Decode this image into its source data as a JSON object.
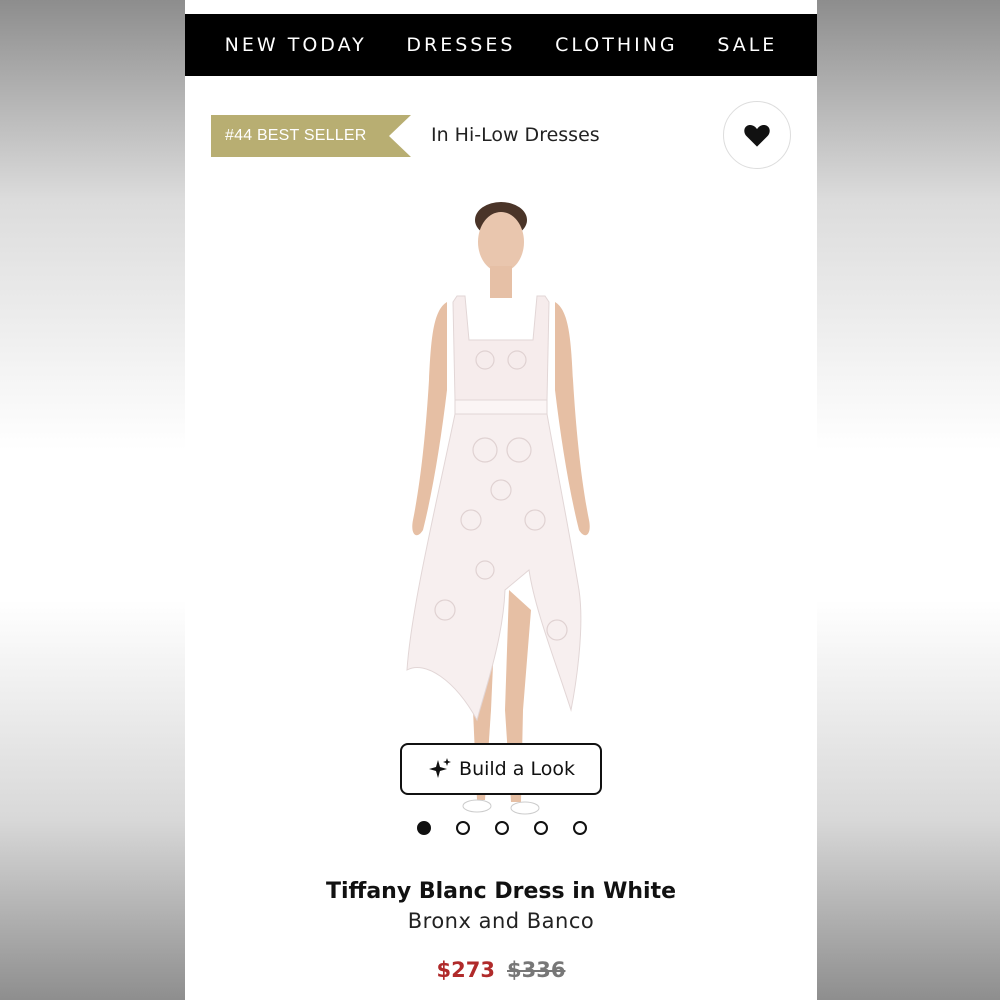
{
  "nav": {
    "items": [
      {
        "label": "NEW TODAY"
      },
      {
        "label": "DRESSES"
      },
      {
        "label": "CLOTHING"
      },
      {
        "label": "SALE"
      }
    ]
  },
  "badge": {
    "rank_label": "#44 BEST SELLER",
    "category": "In Hi-Low Dresses",
    "color": "#b8ae72"
  },
  "favorite": {
    "icon": "heart-icon"
  },
  "image": {
    "description_icon": "product-photo"
  },
  "build_look": {
    "label": "Build a Look",
    "icon": "sparkle-icon"
  },
  "carousel": {
    "count": 5,
    "active_index": 0
  },
  "product": {
    "name": "Tiffany Blanc Dress in White",
    "brand": "Bronx and Banco",
    "sale_price": "$273",
    "original_price": "$336",
    "sale_color": "#b02a2a"
  }
}
